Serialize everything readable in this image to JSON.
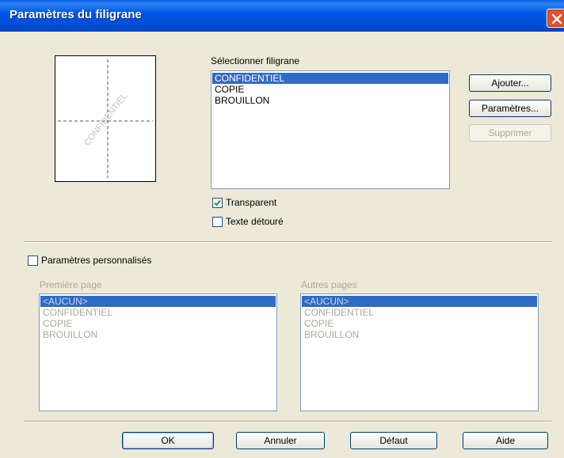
{
  "window": {
    "title": "Paramètres du filigrane"
  },
  "preview": {
    "watermark_text": "CONFIDENTIEL"
  },
  "select_watermark": {
    "label": "Sélectionner filigrane",
    "items": [
      "CONFIDENTIEL",
      "COPIE",
      "BROUILLON"
    ],
    "selected_index": 0
  },
  "buttons": {
    "add": "Ajouter...",
    "settings": "Paramètres...",
    "delete": "Supprimer",
    "ok": "OK",
    "cancel": "Annuler",
    "default": "Défaut",
    "help": "Aide"
  },
  "options": {
    "transparent": {
      "label": "Transparent",
      "checked": true
    },
    "outline_text": {
      "label": "Texte détouré",
      "checked": false
    },
    "custom_settings": {
      "label": "Paramètres personnalisés",
      "checked": false
    }
  },
  "first_page": {
    "label": "Première page",
    "items": [
      "<AUCUN>",
      "CONFIDENTIEL",
      "COPIE",
      "BROUILLON"
    ],
    "selected_index": 0
  },
  "other_pages": {
    "label": "Autres pages",
    "items": [
      "<AUCUN>",
      "CONFIDENTIEL",
      "COPIE",
      "BROUILLON"
    ],
    "selected_index": 0
  },
  "colors": {
    "titlebar": "#0058e6",
    "selection": "#316ac5",
    "dialog_bg": "#ece9d8",
    "close_button": "#e24f2d"
  }
}
